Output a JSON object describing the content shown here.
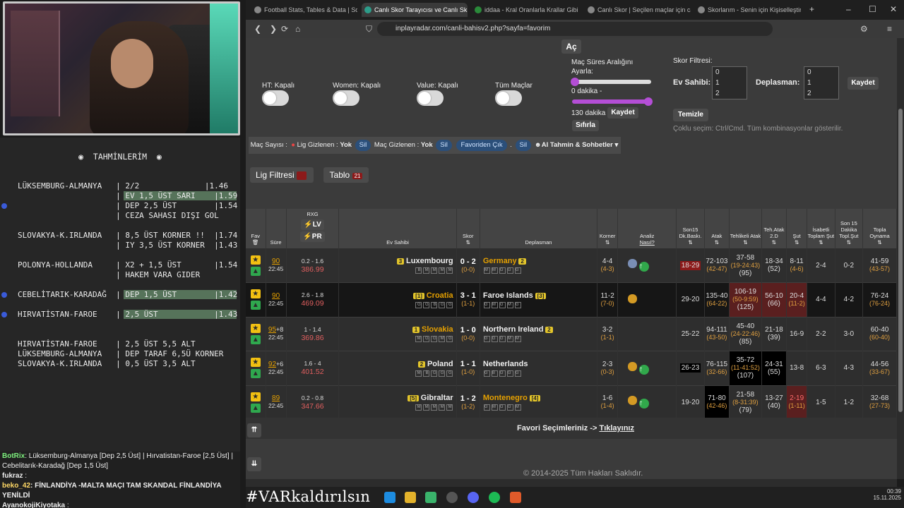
{
  "predictions": {
    "title": "TAHMİNLERİM",
    "lines": [
      {
        "text": "LÜKSEMBURG-ALMANYA   | 2/2              |1.46",
        "hl": false,
        "dot": false
      },
      {
        "text": "                     | EV 1,5 ÜST SARI    |1.59",
        "hl": true,
        "dot": false
      },
      {
        "text": "                     | DEP 2,5 ÜST        |1.54",
        "hl": false,
        "dot": true
      },
      {
        "text": "                     | CEZA SAHASI DIŞI GOL",
        "hl": false,
        "dot": false
      },
      {
        "text": "SLOVAKYA-K.IRLANDA   | 8,5 ÜST KORNER !!  |1.74",
        "hl": false,
        "dot": false
      },
      {
        "text": "                     | IY 3,5 ÜST KORNER  |1.43",
        "hl": false,
        "dot": false
      },
      {
        "text": "POLONYA-HOLLANDA     | X2 + 1,5 ÜST       |1.54",
        "hl": false,
        "dot": false
      },
      {
        "text": "                     | HAKEM VARA GIDER",
        "hl": false,
        "dot": false
      },
      {
        "text": "CEBELİTARIK-KARADAĞ  | DEP 1,5 ÜST        |1.42",
        "hl": true,
        "dot": true
      },
      {
        "text": "HIRVATİSTAN-FAROE    | 2,5 ÜST            |1.43",
        "hl": true,
        "dot": true
      },
      {
        "text": "HIRVATİSTAN-FAROE    | 2,5 ÜST 5,5 ALT",
        "hl": false,
        "dot": false
      },
      {
        "text": "LÜKSEMBURG-ALMANYA   | DEP TARAF 6,5Ü KORNER",
        "hl": false,
        "dot": false
      },
      {
        "text": "SLOVAKYA-K.IRLANDA   | 0,5 ÜST 3,5 ALT",
        "hl": false,
        "dot": false
      }
    ]
  },
  "chat": [
    {
      "user": "BotRix",
      "text": ": Lüksemburg-Almanya [Dep 2,5 Üst] | Hırvatistan-Faroe [2,5 Üst] | Cebelitarık-Karadağ [Dep 1,5 Üst]"
    },
    {
      "user": "fukraz",
      "text": ":"
    },
    {
      "user": "beko_42",
      "text": ": FİNLANDİYA -MALTA MAÇI TAM SKANDAL FİNLANDİYA YENİLDİ"
    },
    {
      "user": "AyanokojiKiyotaka",
      "text": ":"
    }
  ],
  "hashtag": "#VARkaldırılsın",
  "browser": {
    "tabs": [
      "Football Stats, Tables & Data | Socc",
      "Canlı Skor Tarayıcısı ve Canlı Sk",
      "iddaa - Kral Oranlarla Krallar Gibi K",
      "Canlı Skor | Seçilen maçlar için canl",
      "Skorlarım - Senin için Kişiselleştirilm"
    ],
    "url": "inplayradar.com/canli-bahisv2.php?sayfa=favorim"
  },
  "page": {
    "ac_btn": "Aç",
    "ht": "HT: Kapalı",
    "women": "Women: Kapalı",
    "value": "Value: Kapalı",
    "all": "Tüm Maçlar",
    "range_title": "Maç Süres Aralığını Ayarla:",
    "range_from": "0 dakika -",
    "range_to": "130 dakika",
    "kaydet": "Kaydet",
    "sifirla": "Sıfırla",
    "score_filter": "Skor Filtresi:",
    "home": "Ev Sahibi:",
    "away": "Deplasman:",
    "opts": [
      "0",
      "1",
      "2"
    ],
    "temizle": "Temizle",
    "hint": "Çoklu seçim: Ctrl/Cmd. Tüm kombinasyonlar gösterilir.",
    "filterbar": {
      "count": "Maç Sayısı :",
      "lig": "Lig Gizlenen :",
      "yok": "Yok",
      "sil": "Sil",
      "mac": "Maç Gizlenen :",
      "fav": "Favoriden Çık",
      "ai": "AI Tahmin & Sohbetler"
    },
    "lig_btn": "Lig Filtresi",
    "tablo_btn": "Tablo",
    "tablo_count": "21",
    "headers": {
      "fav": "Fav",
      "sure": "Süre",
      "rxg": "RXG",
      "lv": "LV",
      "pr": "PR",
      "ev": "Ev Sahibi",
      "skor": "Skor",
      "dep": "Deplasman",
      "korner": "Korner",
      "analiz": "Analiz",
      "nasil": "Nasıl?",
      "son15": "Son15 Dk.Baskı.",
      "atak": "Atak",
      "tehlikeli": "Tehlikeli Atak",
      "teh2": "Teh.Atak 2.D",
      "sut": "Şut",
      "isabet": "İsabetli Toplam Şut",
      "son15sut": "Son 15 Dakika Topl.Şut",
      "topla": "Topla Oynama"
    },
    "footer": "Favori Seçimleriniz ->",
    "footer_link": "Tıklayınız",
    "copyright": "© 2014-2025 Tüm Hakları Saklıdır."
  },
  "matches": [
    {
      "min": "90",
      "plus": "",
      "time": "22:45",
      "rxg": "0.2 - 1.6",
      "rv": "386.99",
      "home": "Luxembourg",
      "home_badge": "3",
      "home_form": [
        "B",
        "M",
        "M",
        "M",
        "M"
      ],
      "score": "0 - 2",
      "ht": "(0-0)",
      "away": "Germany",
      "away_badge": "2",
      "away_form": [
        "M",
        "M",
        "G",
        "G",
        "G"
      ],
      "corner": "4-4",
      "corner_ht": "(4-3)",
      "son15": "18-29",
      "atak": "72-103",
      "atak_ht": "(42-47)",
      "teh": "37-58",
      "teh_ht": "(19-24:43)",
      "teh_tot": "(95)",
      "teh2": "18-34",
      "teh2_t": "(52)",
      "sut": "8-11",
      "sut_t": "(4-6)",
      "isabet": "2-4",
      "son15sut": "0-2",
      "topla": "41-59",
      "topla_ht": "(43-57)",
      "dark": false
    },
    {
      "min": "90",
      "plus": "",
      "time": "22:45",
      "rxg": "2.6 - 1.8",
      "rv": "469.09",
      "home": "Croatia",
      "home_badge": "[1]",
      "home_form": [
        "G",
        "G",
        "B",
        "G",
        "G"
      ],
      "score": "3 - 1",
      "ht": "(1-1)",
      "away": "Faroe Islands",
      "away_badge": "[3]",
      "away_form": [
        "G",
        "M",
        "G",
        "M",
        "G"
      ],
      "corner": "11-2",
      "corner_ht": "(7-0)",
      "son15": "29-20",
      "atak": "135-40",
      "atak_ht": "(64-22)",
      "teh": "106-19",
      "teh_ht": "(50-9:59)",
      "teh_tot": "(125)",
      "teh2": "56-10",
      "teh2_t": "(66)",
      "sut": "20-4",
      "sut_t": "(11-2)",
      "isabet": "4-4",
      "son15sut": "4-2",
      "topla": "76-24",
      "topla_ht": "(76-24)",
      "dark": true
    },
    {
      "min": "95",
      "plus": "+8",
      "time": "22:45",
      "rxg": "1 - 1.4",
      "rv": "369.86",
      "home": "Slovakia",
      "home_badge": "1",
      "home_form": [
        "M",
        "G",
        "G",
        "M",
        "G"
      ],
      "score": "1 - 0",
      "ht": "(0-0)",
      "away": "Northern Ireland",
      "away_badge": "2",
      "away_form": [
        "G",
        "G",
        "G",
        "M",
        "M"
      ],
      "corner": "3-2",
      "corner_ht": "(1-1)",
      "son15": "25-22",
      "atak": "94-111",
      "atak_ht": "(43-50)",
      "teh": "45-40",
      "teh_ht": "(24-22:46)",
      "teh_tot": "(85)",
      "teh2": "21-18",
      "teh2_t": "(39)",
      "sut": "16-9",
      "sut_t": "",
      "isabet": "2-2",
      "son15sut": "3-0",
      "topla": "60-40",
      "topla_ht": "(60-40)",
      "dark": false
    },
    {
      "min": "92",
      "plus": "+6",
      "time": "22:45",
      "rxg": "1.6 - 4",
      "rv": "401.52",
      "home": "Poland",
      "home_badge": "2",
      "home_form": [
        "M",
        "B",
        "G",
        "G",
        "G"
      ],
      "score": "1 - 1",
      "ht": "(1-0)",
      "away": "Netherlands",
      "away_badge": "",
      "away_form": [
        "G",
        "B",
        "G",
        "G",
        "G"
      ],
      "corner": "2-3",
      "corner_ht": "(0-3)",
      "son15": "26-23",
      "atak": "76-115",
      "atak_ht": "(32-66)",
      "teh": "35-72",
      "teh_ht": "(11-41:52)",
      "teh_tot": "(107)",
      "teh2": "24-31",
      "teh2_t": "(55)",
      "sut": "13-8",
      "sut_t": "",
      "isabet": "6-3",
      "son15sut": "4-3",
      "topla": "44-56",
      "topla_ht": "(33-67)",
      "dark": false
    },
    {
      "min": "89",
      "plus": "",
      "time": "22:45",
      "rxg": "0.2 - 0.8",
      "rv": "347.66",
      "home": "Gibraltar",
      "home_badge": "[5]",
      "home_form": [
        "M",
        "M",
        "M",
        "M",
        "M"
      ],
      "score": "1 - 2",
      "ht": "(1-2)",
      "away": "Montenegro",
      "away_badge": "[4]",
      "away_form": [
        "G",
        "M",
        "G",
        "G",
        "M"
      ],
      "corner": "1-6",
      "corner_ht": "(1-4)",
      "son15": "19-20",
      "atak": "71-80",
      "atak_ht": "(42-46)",
      "teh": "21-58",
      "teh_ht": "(8-31:39)",
      "teh_tot": "(79)",
      "teh2": "13-27",
      "teh2_t": "(40)",
      "sut": "2-19",
      "sut_t": "(1-11)",
      "isabet": "1-5",
      "son15sut": "1-2",
      "topla": "32-68",
      "topla_ht": "(27-73)",
      "dark": false
    }
  ],
  "clock": {
    "time": "00:39",
    "date": "15.11.2025"
  }
}
